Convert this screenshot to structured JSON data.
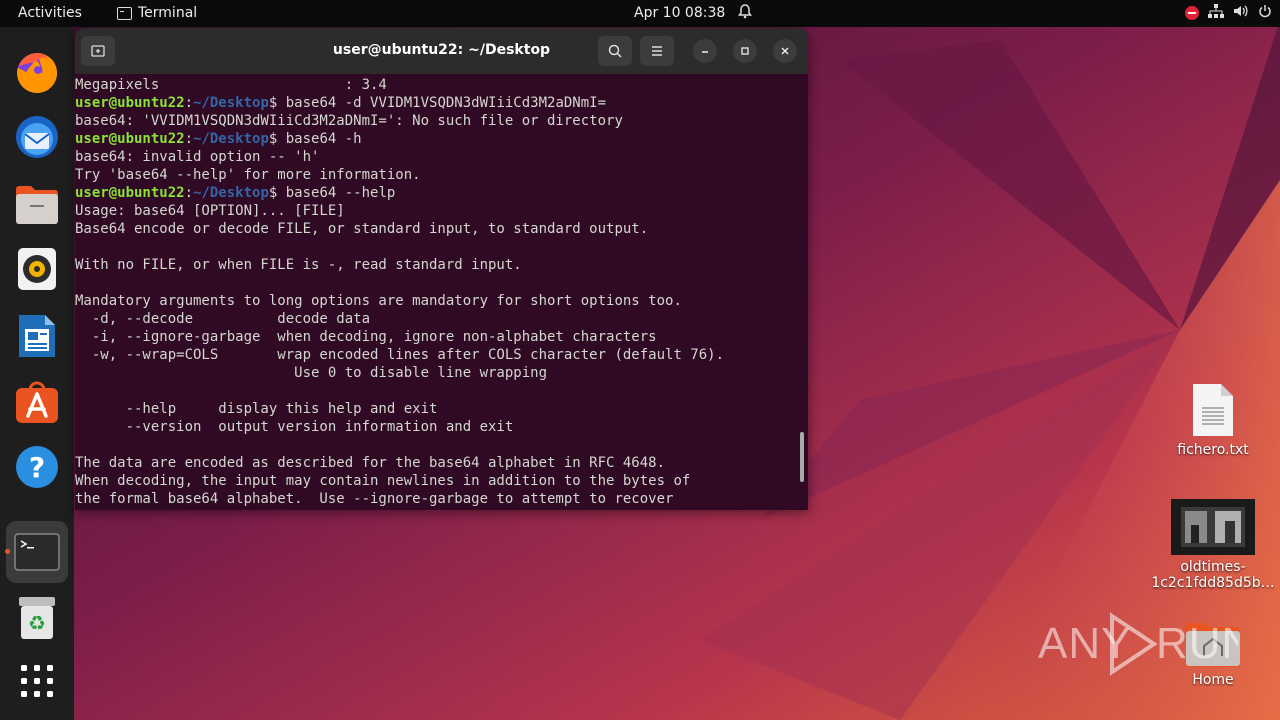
{
  "topbar": {
    "activities": "Activities",
    "app_name": "Terminal",
    "clock": "Apr 10  08:38"
  },
  "dock": {
    "items": [
      "Firefox",
      "Thunderbird",
      "Files",
      "Rhythmbox",
      "LibreOffice Writer",
      "Ubuntu Software",
      "Help",
      "Terminal",
      "Trash",
      "Show Applications"
    ]
  },
  "terminal": {
    "title": "user@ubuntu22: ~/Desktop",
    "prompt_user": "user@ubuntu22",
    "prompt_sep": ":",
    "prompt_path": "~/Desktop",
    "lines": {
      "l0": "Megapixels                      : 3.4",
      "cmd1": "$ base64 -d VVIDM1VSQDN3dWIiiCd3M2aDNmI=",
      "l2": "base64: 'VVIDM1VSQDN3dWIiiCd3M2aDNmI=': No such file or directory",
      "cmd2": "$ base64 -h",
      "l4": "base64: invalid option -- 'h'",
      "l5": "Try 'base64 --help' for more information.",
      "cmd3": "$ base64 --help",
      "l7": "Usage: base64 [OPTION]... [FILE]",
      "l8": "Base64 encode or decode FILE, or standard input, to standard output.",
      "l9": "",
      "l10": "With no FILE, or when FILE is -, read standard input.",
      "l11": "",
      "l12": "Mandatory arguments to long options are mandatory for short options too.",
      "l13": "  -d, --decode          decode data",
      "l14": "  -i, --ignore-garbage  when decoding, ignore non-alphabet characters",
      "l15": "  -w, --wrap=COLS       wrap encoded lines after COLS character (default 76).",
      "l16": "                          Use 0 to disable line wrapping",
      "l17": "",
      "l18": "      --help     display this help and exit",
      "l19": "      --version  output version information and exit",
      "l20": "",
      "l21": "The data are encoded as described for the base64 alphabet in RFC 4648.",
      "l22": "When decoding, the input may contain newlines in addition to the bytes of",
      "l23": "the formal base64 alphabet.  Use --ignore-garbage to attempt to recover"
    }
  },
  "desktop": {
    "file1": "fichero.txt",
    "file2_line1": "oldtimes-",
    "file2_line2": "1c2c1fdd85d5b…",
    "home": "Home"
  },
  "watermark": "ANY RUN",
  "colors": {
    "topbar": "#0b0b0b",
    "dock": "#1e1e1e",
    "terminal_bg": "#300a24",
    "prompt_user": "#8ae234",
    "prompt_path": "#3465a4",
    "accent": "#e95420"
  }
}
